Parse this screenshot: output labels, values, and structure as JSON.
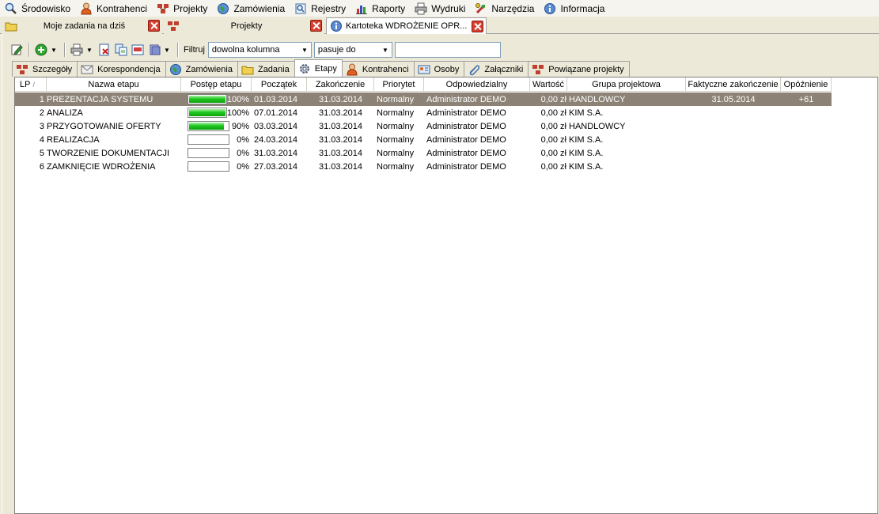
{
  "menu": [
    {
      "label": "Środowisko",
      "icon": "search-globe-icon"
    },
    {
      "label": "Kontrahenci",
      "icon": "person-icon"
    },
    {
      "label": "Projekty",
      "icon": "project-icon"
    },
    {
      "label": "Zamówienia",
      "icon": "globe-icon"
    },
    {
      "label": "Rejestry",
      "icon": "registry-icon"
    },
    {
      "label": "Raporty",
      "icon": "chart-icon"
    },
    {
      "label": "Wydruki",
      "icon": "printer-icon"
    },
    {
      "label": "Narzędzia",
      "icon": "tools-icon"
    },
    {
      "label": "Informacja",
      "icon": "info-icon"
    }
  ],
  "doc_tabs": [
    {
      "label": "Moje zadania na dziś",
      "icon": "folder-icon"
    },
    {
      "label": "Projekty",
      "icon": "project-icon"
    },
    {
      "label": "Kartoteka WDROŻENIE OPR...",
      "icon": "info-icon"
    }
  ],
  "toolbar": {
    "filter_label": "Filtruj",
    "column_select": "dowolna kolumna",
    "match_select": "pasuje do",
    "filter_value": ""
  },
  "sub_tabs": [
    {
      "label": "Szczegóły",
      "icon": "project-icon"
    },
    {
      "label": "Korespondencja",
      "icon": "envelope-icon"
    },
    {
      "label": "Zamówienia",
      "icon": "globe-icon"
    },
    {
      "label": "Zadania",
      "icon": "folder-icon"
    },
    {
      "label": "Etapy",
      "icon": "gear-icon"
    },
    {
      "label": "Kontrahenci",
      "icon": "person-icon"
    },
    {
      "label": "Osoby",
      "icon": "contact-card-icon"
    },
    {
      "label": "Załączniki",
      "icon": "paperclip-icon"
    },
    {
      "label": "Powiązane projekty",
      "icon": "project-icon"
    }
  ],
  "active_sub_tab": "Etapy",
  "grid": {
    "columns": [
      "LP",
      "Nazwa etapu",
      "Postęp etapu",
      "Początek",
      "Zakończenie",
      "Priorytet",
      "Odpowiedzialny",
      "Wartość",
      "Grupa projektowa",
      "Faktyczne zakończenie",
      "Opóźnienie"
    ],
    "sort_indicator": "/",
    "rows": [
      {
        "lp": "1",
        "name": "PREZENTACJA SYSTEMU",
        "progress": 100,
        "progress_label": "100%",
        "start": "01.03.2014",
        "end": "31.03.2014",
        "priority": "Normalny",
        "owner": "Administrator DEMO",
        "value": "0,00 zł",
        "group": "HANDLOWCY",
        "actual_end": "31.05.2014",
        "delay": "+61"
      },
      {
        "lp": "2",
        "name": "ANALIZA",
        "progress": 100,
        "progress_label": "100%",
        "start": "07.01.2014",
        "end": "31.03.2014",
        "priority": "Normalny",
        "owner": "Administrator DEMO",
        "value": "0,00 zł",
        "group": "KIM S.A.",
        "actual_end": "",
        "delay": ""
      },
      {
        "lp": "3",
        "name": "PRZYGOTOWANIE OFERTY",
        "progress": 90,
        "progress_label": "90%",
        "start": "03.03.2014",
        "end": "31.03.2014",
        "priority": "Normalny",
        "owner": "Administrator DEMO",
        "value": "0,00 zł",
        "group": "HANDLOWCY",
        "actual_end": "",
        "delay": ""
      },
      {
        "lp": "4",
        "name": "REALIZACJA",
        "progress": 0,
        "progress_label": "0%",
        "start": "24.03.2014",
        "end": "31.03.2014",
        "priority": "Normalny",
        "owner": "Administrator DEMO",
        "value": "0,00 zł",
        "group": "KIM S.A.",
        "actual_end": "",
        "delay": ""
      },
      {
        "lp": "5",
        "name": "TWORZENIE DOKUMENTACJI",
        "progress": 0,
        "progress_label": "0%",
        "start": "31.03.2014",
        "end": "31.03.2014",
        "priority": "Normalny",
        "owner": "Administrator DEMO",
        "value": "0,00 zł",
        "group": "KIM S.A.",
        "actual_end": "",
        "delay": ""
      },
      {
        "lp": "6",
        "name": "ZAMKNIĘCIE WDROŻENIA",
        "progress": 0,
        "progress_label": "0%",
        "start": "27.03.2014",
        "end": "31.03.2014",
        "priority": "Normalny",
        "owner": "Administrator DEMO",
        "value": "0,00 zł",
        "group": "KIM S.A.",
        "actual_end": "",
        "delay": ""
      }
    ]
  },
  "colors": {
    "selected_row": "#8c8275",
    "progress_fill": "#1ec81e",
    "close_button": "#d44030"
  }
}
